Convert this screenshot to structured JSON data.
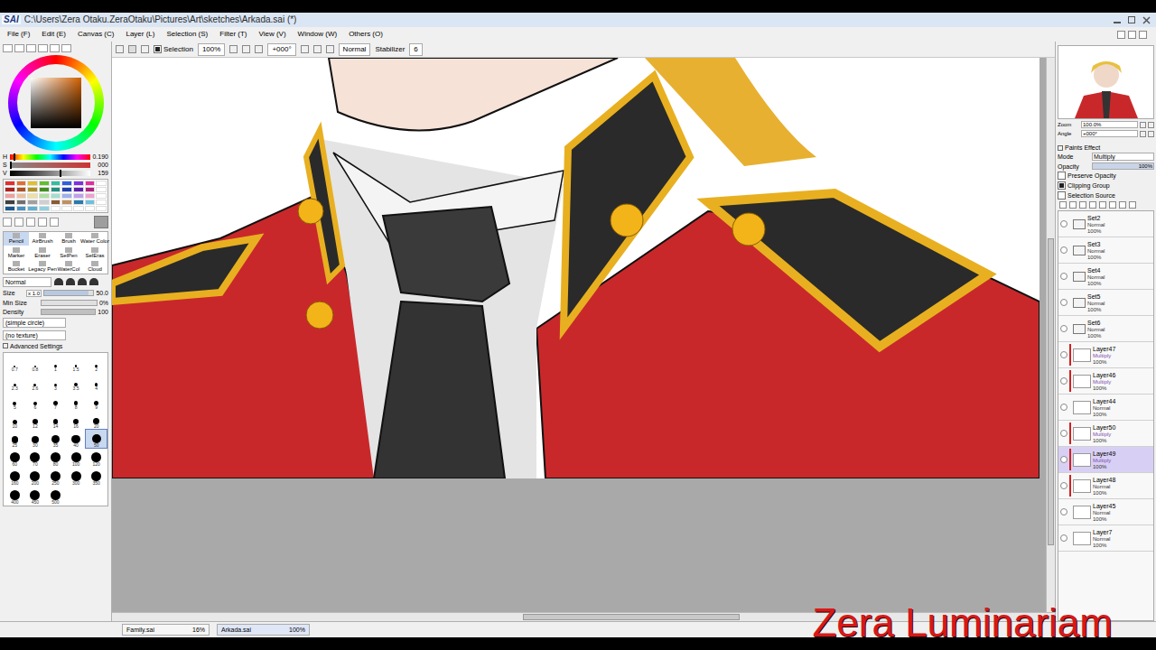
{
  "window": {
    "app": "SAI",
    "title": "C:\\Users\\Zera Otaku.ZeraOtaku\\Pictures\\Art\\sketches\\Arkada.sai (*)"
  },
  "menu": [
    "File (F)",
    "Edit (E)",
    "Canvas (C)",
    "Layer (L)",
    "Selection (S)",
    "Filter (T)",
    "View (V)",
    "Window (W)",
    "Others (O)"
  ],
  "toolbar": {
    "selection": {
      "label": "Selection",
      "checked": true
    },
    "zoom": "100%",
    "angle": "+000°",
    "blend": "Normal",
    "stabilizer": {
      "label": "Stabilizer",
      "value": "6"
    }
  },
  "color": {
    "sliders": [
      {
        "label": "H",
        "value": "0.190",
        "level": 0.05
      },
      {
        "label": "S",
        "value": "000",
        "level": 0.0
      },
      {
        "label": "V",
        "value": "159",
        "level": 0.62
      }
    ],
    "current": "#9e9e9e",
    "swatches": [
      "#e03030",
      "#e07030",
      "#e0c030",
      "#60c030",
      "#30c0a0",
      "#3060e0",
      "#8030e0",
      "#e030a0",
      "#ffffff",
      "#b02020",
      "#b05020",
      "#b09020",
      "#409020",
      "#209080",
      "#2040b0",
      "#6020b0",
      "#b02080",
      "#ffffff",
      "#f0a0a0",
      "#f0c0a0",
      "#f0e0a0",
      "#b0e0a0",
      "#a0e0d0",
      "#a0b0f0",
      "#c0a0f0",
      "#f0a0d0",
      "#ffffff",
      "#404040",
      "#707070",
      "#a0a0a0",
      "#d0d0d0",
      "#8a5a30",
      "#c09060",
      "#2a7ab0",
      "#70c0e0",
      "#ffffff",
      "#1a5a90",
      "#4a90c0",
      "#60b0d0",
      "#90d0e0",
      "#ffffff",
      "#ffffff",
      "#ffffff",
      "#ffffff",
      "#ffffff"
    ]
  },
  "tools": [
    {
      "label": "Pencil",
      "selected": true
    },
    {
      "label": "AirBrush",
      "selected": false
    },
    {
      "label": "Brush",
      "selected": false
    },
    {
      "label": "Water Color",
      "selected": false
    },
    {
      "label": "Marker",
      "selected": false
    },
    {
      "label": "Eraser",
      "selected": false
    },
    {
      "label": "SelPen",
      "selected": false
    },
    {
      "label": "SelEras",
      "selected": false
    },
    {
      "label": "Bucket",
      "selected": false
    },
    {
      "label": "Legacy Pen",
      "selected": false
    },
    {
      "label": "WaterCol",
      "selected": false
    },
    {
      "label": "Cloud",
      "selected": false
    }
  ],
  "brush": {
    "mode": "Normal",
    "size": {
      "label": "Size",
      "multiplier": "x 1.0",
      "value": "50.0",
      "level": 0.9
    },
    "min_size": {
      "label": "Min Size",
      "value": "0%",
      "level": 0.0
    },
    "density": {
      "label": "Density",
      "value": "100",
      "level": 1.0
    },
    "shape": "(simple circle)",
    "texture": "(no texture)",
    "advanced": "Advanced Settings"
  },
  "brush_sizes": [
    {
      "label": "0.7",
      "selected": false
    },
    {
      "label": "0.8",
      "selected": false
    },
    {
      "label": "1",
      "selected": false
    },
    {
      "label": "1.5",
      "selected": false
    },
    {
      "label": "2",
      "selected": false
    },
    {
      "label": "2.3",
      "selected": false
    },
    {
      "label": "2.6",
      "selected": false
    },
    {
      "label": "3",
      "selected": false
    },
    {
      "label": "3.5",
      "selected": false
    },
    {
      "label": "4",
      "selected": false
    },
    {
      "label": "5",
      "selected": false
    },
    {
      "label": "6",
      "selected": false
    },
    {
      "label": "7",
      "selected": false
    },
    {
      "label": "8",
      "selected": false
    },
    {
      "label": "9",
      "selected": false
    },
    {
      "label": "10",
      "selected": false
    },
    {
      "label": "12",
      "selected": false
    },
    {
      "label": "14",
      "selected": false
    },
    {
      "label": "16",
      "selected": false
    },
    {
      "label": "20",
      "selected": false
    },
    {
      "label": "25",
      "selected": false
    },
    {
      "label": "30",
      "selected": false
    },
    {
      "label": "35",
      "selected": false
    },
    {
      "label": "40",
      "selected": false
    },
    {
      "label": "50",
      "selected": true
    },
    {
      "label": "60",
      "selected": false
    },
    {
      "label": "70",
      "selected": false
    },
    {
      "label": "80",
      "selected": false
    },
    {
      "label": "100",
      "selected": false
    },
    {
      "label": "120",
      "selected": false
    },
    {
      "label": "160",
      "selected": false
    },
    {
      "label": "200",
      "selected": false
    },
    {
      "label": "250",
      "selected": false
    },
    {
      "label": "300",
      "selected": false
    },
    {
      "label": "350",
      "selected": false
    },
    {
      "label": "400",
      "selected": false
    },
    {
      "label": "450",
      "selected": false
    },
    {
      "label": "500",
      "selected": false
    }
  ],
  "navigator": {
    "zoom": {
      "label": "Zoom",
      "value": "100.0%"
    },
    "angle": {
      "label": "Angle",
      "value": "+000°"
    }
  },
  "layer_props": {
    "paper_effect": "Paints Effect",
    "mode": {
      "label": "Mode",
      "value": "Multiply"
    },
    "opacity": {
      "label": "Opacity",
      "value": "100%",
      "level": 1.0
    },
    "checks": [
      {
        "label": "Preserve Opacity",
        "checked": false
      },
      {
        "label": "Clipping Group",
        "checked": true
      },
      {
        "label": "Selection Source",
        "checked": false
      }
    ]
  },
  "layers": [
    {
      "name": "Set2",
      "mode": "Normal",
      "opacity": "100%",
      "kind": "set",
      "clipped": false,
      "selected": false
    },
    {
      "name": "Set3",
      "mode": "Normal",
      "opacity": "100%",
      "kind": "set",
      "clipped": false,
      "selected": false
    },
    {
      "name": "Set4",
      "mode": "Normal",
      "opacity": "100%",
      "kind": "set",
      "clipped": false,
      "selected": false
    },
    {
      "name": "Set5",
      "mode": "Normal",
      "opacity": "100%",
      "kind": "set",
      "clipped": false,
      "selected": false
    },
    {
      "name": "Set6",
      "mode": "Normal",
      "opacity": "100%",
      "kind": "set",
      "clipped": false,
      "selected": false
    },
    {
      "name": "Layer47",
      "mode": "Multiply",
      "opacity": "100%",
      "kind": "layer",
      "clipped": true,
      "selected": false
    },
    {
      "name": "Layer46",
      "mode": "Multiply",
      "opacity": "100%",
      "kind": "layer",
      "clipped": true,
      "selected": false
    },
    {
      "name": "Layer44",
      "mode": "Normal",
      "opacity": "100%",
      "kind": "layer",
      "clipped": false,
      "selected": false
    },
    {
      "name": "Layer50",
      "mode": "Multiply",
      "opacity": "100%",
      "kind": "layer",
      "clipped": true,
      "selected": false
    },
    {
      "name": "Layer49",
      "mode": "Multiply",
      "opacity": "100%",
      "kind": "layer",
      "clipped": true,
      "selected": true
    },
    {
      "name": "Layer48",
      "mode": "Normal",
      "opacity": "100%",
      "kind": "layer",
      "clipped": true,
      "selected": false
    },
    {
      "name": "Layer45",
      "mode": "Normal",
      "opacity": "100%",
      "kind": "layer",
      "clipped": false,
      "selected": false
    },
    {
      "name": "Layer7",
      "mode": "Normal",
      "opacity": "100%",
      "kind": "layer",
      "clipped": false,
      "selected": false
    }
  ],
  "documents": [
    {
      "name": "Family.sai",
      "zoom": "16%",
      "selected": false
    },
    {
      "name": "Arkada.sai",
      "zoom": "100%",
      "selected": true
    }
  ],
  "watermark": "Zera Luminariam"
}
